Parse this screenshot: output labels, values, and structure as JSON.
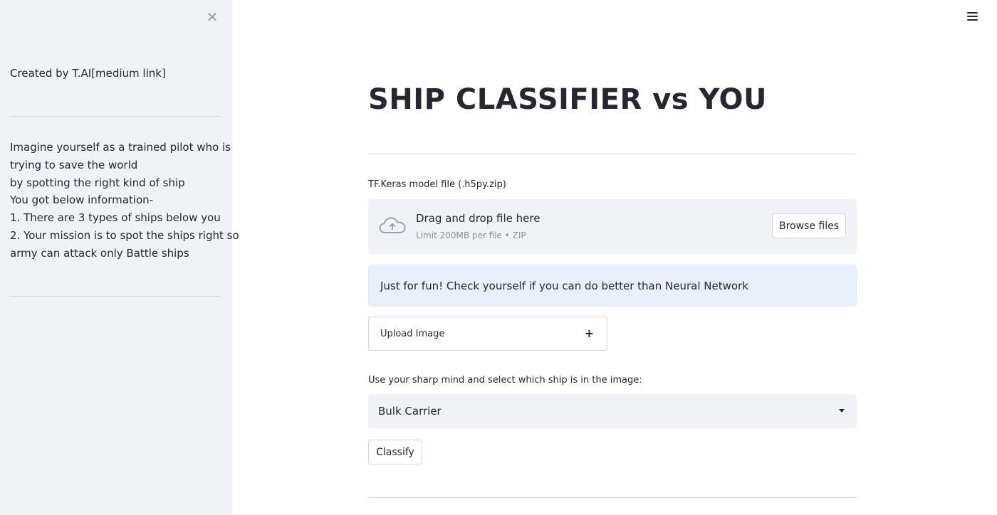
{
  "sidebar": {
    "close_icon": "close-icon",
    "created_by": "Created by T.AI[medium link]",
    "intro_lines": [
      "Imagine yourself as a trained pilot who is",
      "trying to save the world",
      "by spotting the right kind of ship",
      "You got below information-",
      "1. There are 3 types of ships below you",
      "2. Your mission is to spot the ships right so",
      "army can attack only Battle ships"
    ]
  },
  "header": {
    "menu_icon": "hamburger-menu-icon"
  },
  "main": {
    "title": "SHIP CLASSIFIER vs YOU",
    "uploader": {
      "label": "TF.Keras model file (.h5py.zip)",
      "drop_text": "Drag and drop file here",
      "limit_text": "Limit 200MB per file • ZIP",
      "browse_label": "Browse files",
      "icon": "cloud-upload-icon"
    },
    "info_text": "Just for fun! Check yourself if you can do better than Neural Network",
    "expander": {
      "label": "Upload Image",
      "icon": "+"
    },
    "select": {
      "label": "Use your sharp mind and select which ship is in the image:",
      "value": "Bulk Carrier"
    },
    "classify_label": "Classify"
  },
  "colors": {
    "sidebar_bg": "#f0f2f6",
    "info_bg": "#e8f0fc",
    "text": "#262730"
  }
}
